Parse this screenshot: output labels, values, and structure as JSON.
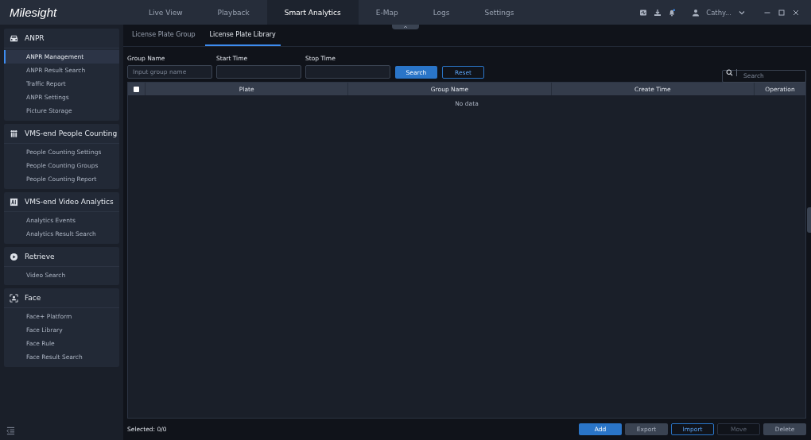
{
  "app": {
    "logo": "Milesight",
    "user": "Cathy..."
  },
  "nav": [
    {
      "label": "Live View",
      "selected": false
    },
    {
      "label": "Playback",
      "selected": false
    },
    {
      "label": "Smart Analytics",
      "selected": true
    },
    {
      "label": "E-Map",
      "selected": false
    },
    {
      "label": "Logs",
      "selected": false
    },
    {
      "label": "Settings",
      "selected": false
    }
  ],
  "sidebar": [
    {
      "title": "ANPR",
      "kind": "car",
      "items": [
        {
          "label": "ANPR Management",
          "selected": true
        },
        {
          "label": "ANPR Result Search",
          "selected": false
        },
        {
          "label": "Traffic Report",
          "selected": false
        },
        {
          "label": "ANPR Settings",
          "selected": false
        },
        {
          "label": "Picture Storage",
          "selected": false
        }
      ]
    },
    {
      "title": "VMS-end People Counting",
      "kind": "people",
      "items": [
        {
          "label": "People Counting Settings",
          "selected": false
        },
        {
          "label": "People Counting Groups",
          "selected": false
        },
        {
          "label": "People Counting Report",
          "selected": false
        }
      ]
    },
    {
      "title": "VMS-end Video Analytics",
      "kind": "ai",
      "items": [
        {
          "label": "Analytics Events",
          "selected": false
        },
        {
          "label": "Analytics Result Search",
          "selected": false
        }
      ]
    },
    {
      "title": "Retrieve",
      "kind": "play",
      "items": [
        {
          "label": "Video Search",
          "selected": false
        }
      ]
    },
    {
      "title": "Face",
      "kind": "face",
      "items": [
        {
          "label": "Face+ Platform",
          "selected": false
        },
        {
          "label": "Face Library",
          "selected": false
        },
        {
          "label": "Face Rule",
          "selected": false
        },
        {
          "label": "Face Result Search",
          "selected": false
        }
      ]
    }
  ],
  "tabs": [
    {
      "label": "License Plate Group",
      "selected": false
    },
    {
      "label": "License Plate Library",
      "selected": true
    }
  ],
  "filters": [
    {
      "label": "Group Name",
      "placeholder": "Input group name"
    },
    {
      "label": "Start Time"
    },
    {
      "label": "Stop Time"
    }
  ],
  "search_button": "Search",
  "reset_button": "Reset",
  "search": {
    "placeholder": "Search"
  },
  "table": {
    "select_all": {
      "checked": false
    },
    "columns": [
      "Plate",
      "Group Name",
      "Create Time",
      "Operation"
    ],
    "empty": "No data"
  },
  "footer": {
    "selected": "Selected: 0/0",
    "buttons": [
      {
        "label": "Add",
        "kind": "primary"
      },
      {
        "label": "Export",
        "kind": "normal"
      },
      {
        "label": "Import",
        "kind": "outline"
      },
      {
        "label": "Move",
        "kind": "disabled"
      },
      {
        "label": "Delete",
        "kind": "normal"
      }
    ]
  }
}
